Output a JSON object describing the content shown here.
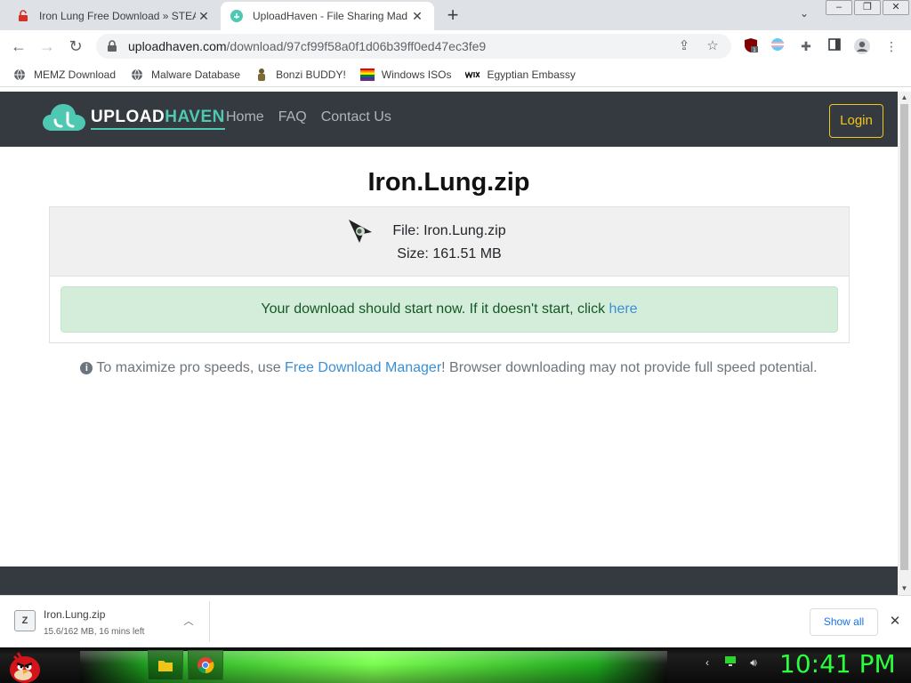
{
  "browser": {
    "tabs": [
      {
        "title": "Iron Lung Free Download » STEA",
        "active": false
      },
      {
        "title": "UploadHaven - File Sharing Mad",
        "active": true
      }
    ],
    "address": {
      "host": "uploadhaven.com",
      "path": "/download/97cf99f58a0f1d06b39ff0ed47ec3fe9"
    },
    "extension_badge": "1",
    "bookmarks": [
      "MEMZ Download",
      "Malware Database",
      "Bonzi BUDDY!",
      "Windows ISOs",
      "Egyptian Embassy"
    ]
  },
  "site": {
    "logo": {
      "part1": "UPLOAD",
      "part2": "HAVEN"
    },
    "nav": [
      "Home",
      "FAQ",
      "Contact Us"
    ],
    "login_label": "Login",
    "title": "Iron.Lung.zip",
    "file_line": "File: Iron.Lung.zip",
    "size_line": "Size: 161.51 MB",
    "alert_text": "Your download should start now. If it doesn't start, click ",
    "alert_link": "here",
    "tip_before": "To maximize pro speeds, use ",
    "tip_link": "Free Download Manager",
    "tip_after": "! Browser downloading may not provide full speed potential."
  },
  "download": {
    "name": "Iron.Lung.zip",
    "status": "15.6/162 MB, 16 mins left",
    "show_all": "Show all"
  },
  "taskbar": {
    "clock": "10:41 PM"
  },
  "colors": {
    "site_nav": "#343a40",
    "brand": "#4fc8b1",
    "login": "#f5c518",
    "alert_bg": "#d4edda",
    "link": "#3a8fd6",
    "clock": "#2bff3c"
  }
}
